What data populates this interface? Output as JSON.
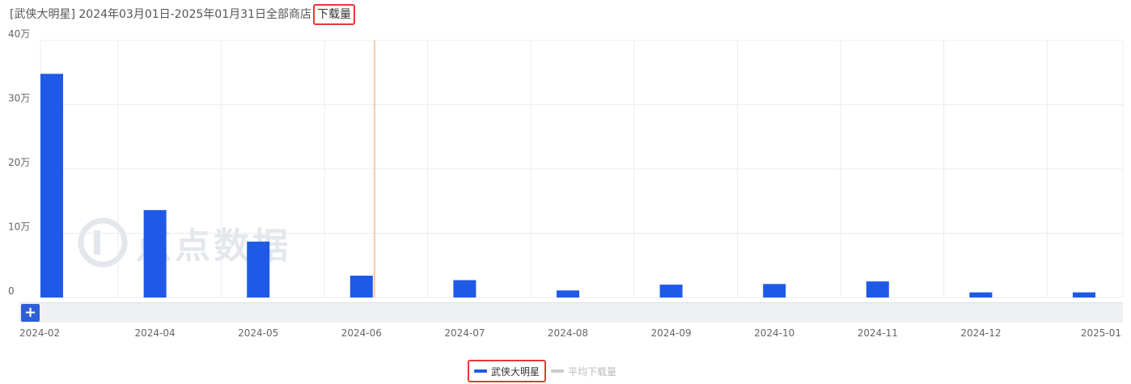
{
  "title": {
    "main": "[武侠大明星] 2024年03月01日-2025年01月31日全部商店",
    "highlight": "下载量"
  },
  "watermark": {
    "text": "点点数据"
  },
  "legend": {
    "items": [
      {
        "label": "武侠大明星",
        "color": "#1f5ae6",
        "active": true
      },
      {
        "label": "平均下载量",
        "color": "#cccccc",
        "active": false
      }
    ]
  },
  "zoom": {
    "plus_label": "+"
  },
  "colors": {
    "bar": "#1f5ae6",
    "grid": "#ececec",
    "marker_line": "#f7c7a6"
  },
  "chart_data": {
    "type": "bar",
    "categories": [
      "2024-02",
      "2024-04",
      "2024-05",
      "2024-06",
      "2024-07",
      "2024-08",
      "2024-09",
      "2024-10",
      "2024-11",
      "2024-12",
      "2025-01"
    ],
    "series": [
      {
        "name": "武侠大明星",
        "values": [
          348000,
          136000,
          87000,
          34000,
          27000,
          11000,
          20000,
          21000,
          25000,
          8000,
          8000
        ]
      }
    ],
    "y_ticks": [
      {
        "value": 0,
        "label": "0"
      },
      {
        "value": 100000,
        "label": "10万"
      },
      {
        "value": 200000,
        "label": "20万"
      },
      {
        "value": 300000,
        "label": "30万"
      },
      {
        "value": 400000,
        "label": "40万"
      }
    ],
    "ylim": [
      0,
      400000
    ],
    "marker_category_index": 3,
    "grid": true,
    "legend_position": "bottom"
  }
}
